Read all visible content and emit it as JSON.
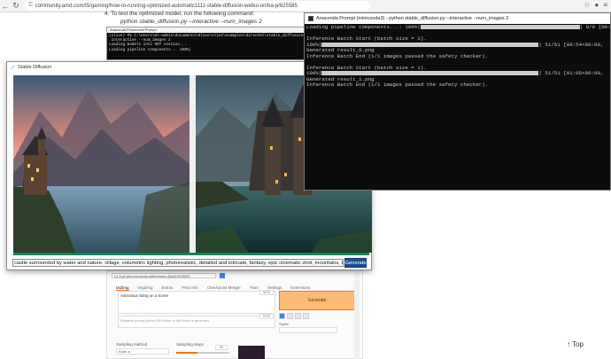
{
  "browser": {
    "url": "community.amd.com/t5/gaming/how-to-running-optimized-automatic1111-stable-diffusion-webui-on/ba-p/625585",
    "back_icon": "←",
    "reload_icon": "↻",
    "lock_icon": "🔒"
  },
  "article": {
    "intro_line": "4. To test the optimized model, run the following command:",
    "command": "python stable_diffusion.py --interactive --num_images 2"
  },
  "small_terminal": {
    "title": "Anaconda Powershell Prompt",
    "lines": "(olive) PS C:\\Users\\ml-admin\\documents\\Olive\\olive\\examples\\directml\\stable_diffusion> python\n interactive --num_images 2\nLoading models into ORT session...\nLoading pipeline components... 100%|"
  },
  "webui": {
    "checkpoint": "v1-5-pruned-emaonly.safetensors [6ce0161689]",
    "tabs": [
      "txt2img",
      "img2img",
      "Extras",
      "PNG Info",
      "Checkpoint Merger",
      "Train",
      "Settings",
      "Extensions"
    ],
    "prompt": "Astronaut riding on a horse",
    "prompt_count": "5/75",
    "negative_placeholder": "Negative prompt (press Ctrl+Enter or Alt+Enter to generate)",
    "negative_count": "0/75",
    "generate_label": "Generate",
    "styles_label": "Styles",
    "sampling_method_label": "Sampling method",
    "sampling_method_value": "Euler a",
    "sampling_steps_label": "Sampling steps",
    "sampling_steps_value": "20"
  },
  "top_button": {
    "label": "Top",
    "arrow": "↑"
  },
  "sd_window": {
    "title": "Stable Diffusion",
    "prompt_value": "castle surrounded by water and nature, village, volumetric lighting, photorealistic, detailed and intricate, fantasy, epic cinematic shot, mountains, 8k ultra hd",
    "generate_label": "Generate",
    "progress_fraction": 1.0
  },
  "terminal": {
    "title": "Anaconda Prompt (miniconda3) - python  stable_diffusion.py --interactive --num_images 2",
    "lines": [
      {
        "text": "Loading pipeline components...: 100%|",
        "bar": 180,
        "tail": "| 8/8 [00:10<00:00,  1"
      },
      {
        "text": "",
        "bar": 0,
        "tail": ""
      },
      {
        "text": "Inference Batch Start (batch size = 1).",
        "bar": 0,
        "tail": ""
      },
      {
        "text": "100%|",
        "bar": 245,
        "tail": "| 51/51 [00:54<00:00,  1"
      },
      {
        "text": "Generated result_0.png",
        "bar": 0,
        "tail": ""
      },
      {
        "text": "Inference Batch End (1/1 images passed the safety checker).",
        "bar": 0,
        "tail": ""
      },
      {
        "text": "",
        "bar": 0,
        "tail": ""
      },
      {
        "text": "Inference Batch Start (batch size = 1).",
        "bar": 0,
        "tail": ""
      },
      {
        "text": "100%|",
        "bar": 245,
        "tail": "| 51/51 [01:05<00:00,  1"
      },
      {
        "text": "Generated result_1.png",
        "bar": 0,
        "tail": ""
      },
      {
        "text": "Inference Batch End (1/1 images passed the safety checker).",
        "bar": 0,
        "tail": ""
      }
    ]
  }
}
